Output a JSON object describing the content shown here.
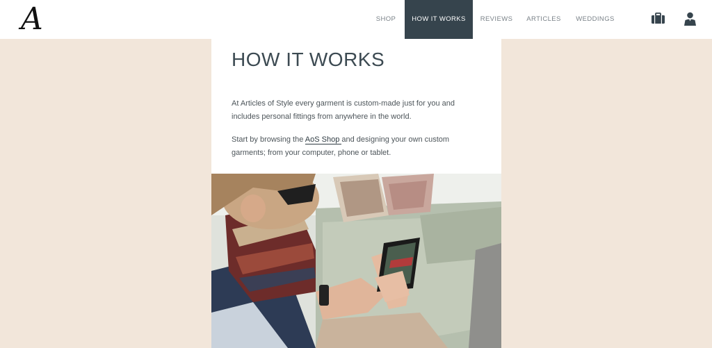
{
  "brand": {
    "logo_text": "A"
  },
  "nav": {
    "items": [
      {
        "label": "SHOP"
      },
      {
        "label": "HOW IT WORKS",
        "active": true
      },
      {
        "label": "REVIEWS"
      },
      {
        "label": "ARTICLES"
      },
      {
        "label": "WEDDINGS"
      }
    ],
    "icons": [
      "briefcase-icon",
      "user-icon"
    ]
  },
  "main": {
    "title": "HOW IT WORKS",
    "para1": "At Articles of Style every garment is custom-made just for you and includes personal fittings from anywhere in the world.",
    "para2_before": "Start by browsing the ",
    "para2_link": "AoS Shop ",
    "para2_after": "and designing your own custom garments; from your computer, phone or tablet."
  },
  "colors": {
    "page_bg": "#f2e6da",
    "nav_active_bg": "#36444d",
    "title": "#3c4a52"
  }
}
